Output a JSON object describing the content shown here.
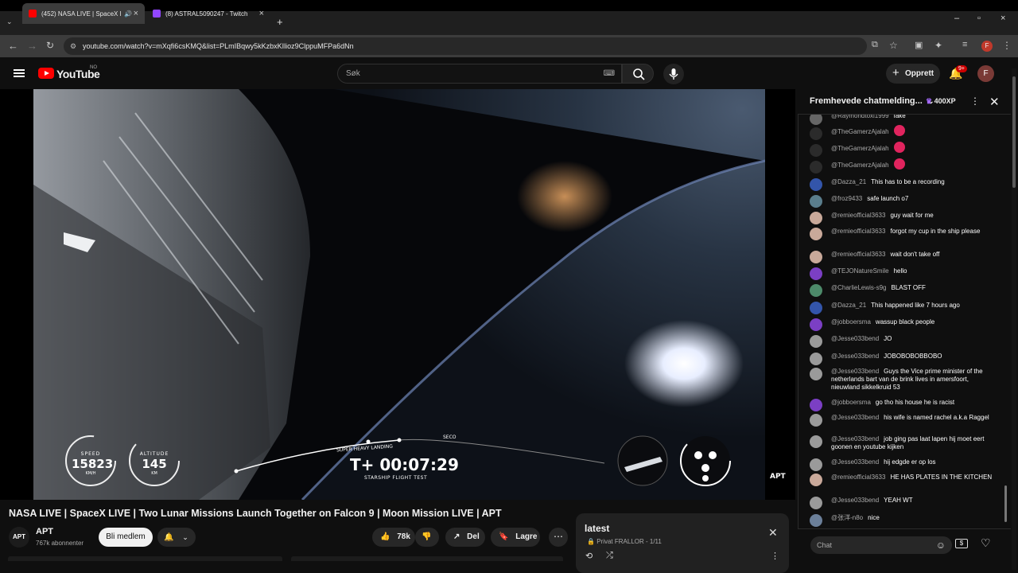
{
  "browser": {
    "tabs": [
      {
        "label": "(452) NASA LIVE | SpaceX L",
        "active": true,
        "icon": "youtube-favicon"
      },
      {
        "label": "(8) ASTRAL5090247 - Twitch",
        "active": false,
        "icon": "twitch-favicon"
      }
    ],
    "url": "youtube.com/watch?v=mXqfi6csKMQ&list=PLmIBqwy5kKzbxKIlioz9ClppuMFPa6dNn",
    "profile_initial": "F"
  },
  "youtube": {
    "logo_text": "YouTube",
    "country_code": "NO",
    "search_placeholder": "Søk",
    "create_label": "Opprett",
    "notifications_badge": "9+",
    "avatar_initial": "F"
  },
  "video": {
    "hud": {
      "speed_label": "SPEED",
      "speed_value": "15823",
      "speed_unit": "KM/H",
      "altitude_label": "ALTITUDE",
      "altitude_value": "145",
      "altitude_unit": "KM",
      "timer": "T+ 00:07:29",
      "subtitle": "STARSHIP FLIGHT TEST",
      "marker_landing": "SUPER HEAVY LANDING",
      "marker_seco": "SECO",
      "watermark": "APT"
    },
    "title": "NASA LIVE | SpaceX LIVE | Two Lunar Missions Launch Together on Falcon 9 | Moon Mission LIVE | APT",
    "channel_name": "APT",
    "channel_subs": "767k abonnenter",
    "member_label": "Bli medlem",
    "like_count": "78k",
    "share_label": "Del",
    "save_label": "Lagre"
  },
  "playlist": {
    "title": "latest",
    "meta": "Privat  FRALLOR - 1/11"
  },
  "chat": {
    "header": "Fremhevede chatmelding...",
    "xp": "400XP",
    "input_placeholder": "Chat",
    "messages": [
      {
        "author": "@Raymondtoxi1999",
        "text": "fake",
        "color": "#666666"
      },
      {
        "author": "@TheGamerzAjalah",
        "text": "",
        "color": "#2b2b2b",
        "emoji": true
      },
      {
        "author": "@TheGamerzAjalah",
        "text": "",
        "color": "#2b2b2b",
        "emoji": true
      },
      {
        "author": "@TheGamerzAjalah",
        "text": "",
        "color": "#2b2b2b",
        "emoji": true
      },
      {
        "author": "@Dazza_21",
        "text": "This has to be a recording",
        "color": "#3355aa"
      },
      {
        "author": "@froz9433",
        "text": "safe launch o7",
        "color": "#5a7d8c"
      },
      {
        "author": "@remieofficial3633",
        "text": "guy wait for me",
        "color": "#c9a99a"
      },
      {
        "author": "@remieofficial3633",
        "text": "forgot my cup in the ship please",
        "color": "#c9a99a"
      },
      {
        "author": "@remieofficial3633",
        "text": "wait don't take off",
        "color": "#c9a99a"
      },
      {
        "author": "@TEJONatureSmile",
        "text": "hello",
        "color": "#7b3fc4"
      },
      {
        "author": "@CharlieLewis-s9g",
        "text": "BLAST OFF",
        "color": "#4d8a6a"
      },
      {
        "author": "@Dazza_21",
        "text": "This happened like 7 hours ago",
        "color": "#3355aa"
      },
      {
        "author": "@jobboersma",
        "text": "wassup black people",
        "color": "#7b3fc4"
      },
      {
        "author": "@Jesse033bend",
        "text": "JO",
        "color": "#9a9a9a"
      },
      {
        "author": "@Jesse033bend",
        "text": "JOBOBOBOBBOBO",
        "color": "#9a9a9a"
      },
      {
        "author": "@Jesse033bend",
        "text": "Guys the Vice prime minister of the netherlands bart van de brink lives in amersfoort, nieuwland sikkelkruid 53",
        "color": "#9a9a9a"
      },
      {
        "author": "@jobboersma",
        "text": "go tho his house he is racist",
        "color": "#7b3fc4"
      },
      {
        "author": "@Jesse033bend",
        "text": "his wife is named rachel a.k.a Raggel",
        "color": "#9a9a9a"
      },
      {
        "author": "@Jesse033bend",
        "text": "job ging pas laat lapen hij moet eert goonen en youtube kijken",
        "color": "#9a9a9a"
      },
      {
        "author": "@Jesse033bend",
        "text": "hij edgde er op los",
        "color": "#9a9a9a"
      },
      {
        "author": "@remieofficial3633",
        "text": "HE HAS PLATES IN THE KITCHEN",
        "color": "#c9a99a"
      },
      {
        "author": "@Jesse033bend",
        "text": "YEAH WT",
        "color": "#9a9a9a"
      },
      {
        "author": "@张洋-n8o",
        "text": "nice",
        "color": "#6b7f99"
      }
    ]
  }
}
